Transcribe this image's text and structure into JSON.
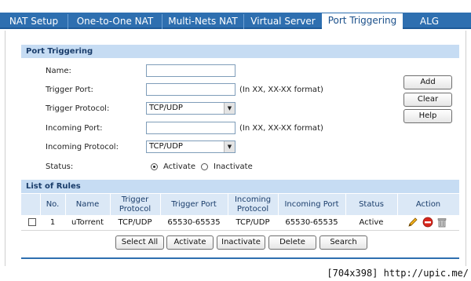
{
  "tabs": [
    {
      "label": "NAT Setup"
    },
    {
      "label": "One-to-One NAT"
    },
    {
      "label": "Multi-Nets NAT"
    },
    {
      "label": "Virtual Server"
    },
    {
      "label": "Port Triggering"
    },
    {
      "label": "ALG"
    }
  ],
  "active_tab": "Port Triggering",
  "form": {
    "section_title": "Port Triggering",
    "name_label": "Name:",
    "name_value": "",
    "trigger_port_label": "Trigger Port:",
    "trigger_port_value": "",
    "trigger_port_hint": "(In XX, XX-XX format)",
    "trigger_protocol_label": "Trigger Protocol:",
    "trigger_protocol_value": "TCP/UDP",
    "incoming_port_label": "Incoming Port:",
    "incoming_port_value": "",
    "incoming_port_hint": "(In XX, XX-XX format)",
    "incoming_protocol_label": "Incoming Protocol:",
    "incoming_protocol_value": "TCP/UDP",
    "status_label": "Status:",
    "status_activate": "Activate",
    "status_inactivate": "Inactivate",
    "status_selected": "Activate"
  },
  "side_buttons": {
    "add": "Add",
    "clear": "Clear",
    "help": "Help"
  },
  "rules": {
    "section_title": "List of Rules",
    "headers": {
      "no": "No.",
      "name": "Name",
      "trigger_protocol": "Trigger Protocol",
      "trigger_port": "Trigger Port",
      "incoming_protocol": "Incoming Protocol",
      "incoming_port": "Incoming Port",
      "status": "Status",
      "action": "Action"
    },
    "rows": [
      {
        "checked": false,
        "no": "1",
        "name": "uTorrent",
        "trigger_protocol": "TCP/UDP",
        "trigger_port": "65530-65535",
        "incoming_protocol": "TCP/UDP",
        "incoming_port": "65530-65535",
        "status": "Active"
      }
    ]
  },
  "bottom_buttons": {
    "select_all": "Select All",
    "activate": "Activate",
    "inactivate": "Inactivate",
    "delete": "Delete",
    "search": "Search"
  },
  "watermark": "[704x398] http://upic.me/",
  "colors": {
    "tab_bar": "#2e6fb0",
    "section_bar": "#c6dcf3",
    "header_text": "#1a3d6b"
  }
}
